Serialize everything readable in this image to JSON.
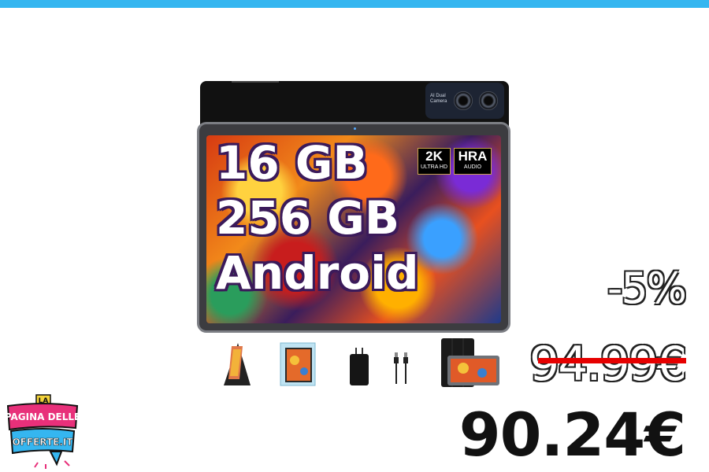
{
  "product": {
    "camera_label": "AI Dual Camera",
    "specs": [
      "16 GB",
      "256 GB",
      "Android"
    ],
    "badges": [
      {
        "big": "2K",
        "small": "ULTRA HD"
      },
      {
        "big": "HRA",
        "small": "AUDIO"
      }
    ]
  },
  "accessories": [
    "stand-cover-icon",
    "screen-protector-icon",
    "charger-icon",
    "usb-cable-icon",
    "folio-case-icon"
  ],
  "pricing": {
    "discount": "-5%",
    "old_price": "94.99€",
    "price": "90.24€"
  },
  "logo": {
    "top": "LA",
    "line1": "PAGINA DELLE",
    "line2": "OFFERTE.IT"
  },
  "colors": {
    "accent": "#35b6f0",
    "strike": "#e60000",
    "logo_pink": "#e8307a"
  }
}
